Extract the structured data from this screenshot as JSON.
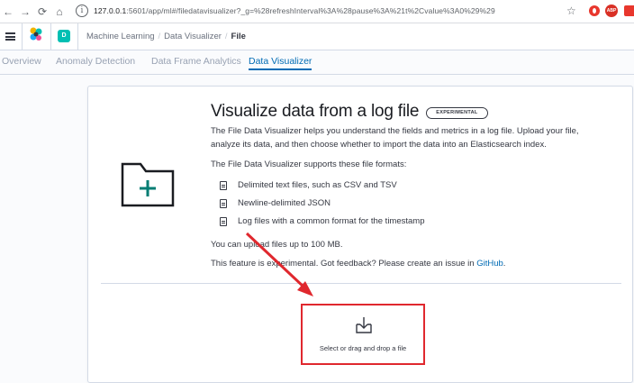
{
  "browser": {
    "back_icon": "arrow-left-icon",
    "forward_icon": "arrow-right-icon",
    "reload_icon": "reload-icon",
    "home_icon": "home-icon",
    "url_host": "127.0.0.1",
    "url_path": ":5601/app/ml#/filedatavisualizer?_g=%28refreshInterval%3A%28pause%3A%21t%2Cvalue%3A0%29%29",
    "ext2_label": "ABP"
  },
  "header": {
    "space_initial": "D",
    "breadcrumbs": [
      "Machine Learning",
      "Data Visualizer",
      "File"
    ]
  },
  "tabs": [
    {
      "label": "Overview"
    },
    {
      "label": "Anomaly Detection"
    },
    {
      "label": "Data Frame Analytics"
    },
    {
      "label": "Data Visualizer"
    }
  ],
  "active_tab": "Data Visualizer",
  "content": {
    "title": "Visualize data from a log file",
    "badge": "EXPERIMENTAL",
    "intro_line1": "The File Data Visualizer helps you understand the fields and metrics in a log file. Upload your file,",
    "intro_line2": "analyze its data, and then choose whether to import the data into an Elasticsearch index.",
    "formats_heading": "The File Data Visualizer supports these file formats:",
    "formats": [
      "Delimited text files, such as CSV and TSV",
      "Newline-delimited JSON",
      "Log files with a common format for the timestamp"
    ],
    "limit_text": "You can upload files up to 100 MB.",
    "feedback_text": "This feature is experimental. Got feedback? Please create an issue in ",
    "feedback_link": "GitHub",
    "feedback_end": "."
  },
  "dropzone": {
    "label": "Select or drag and drop a file"
  },
  "colors": {
    "accent": "#006bb4",
    "annotation": "#e0282e",
    "folder_plus": "#017d73"
  }
}
